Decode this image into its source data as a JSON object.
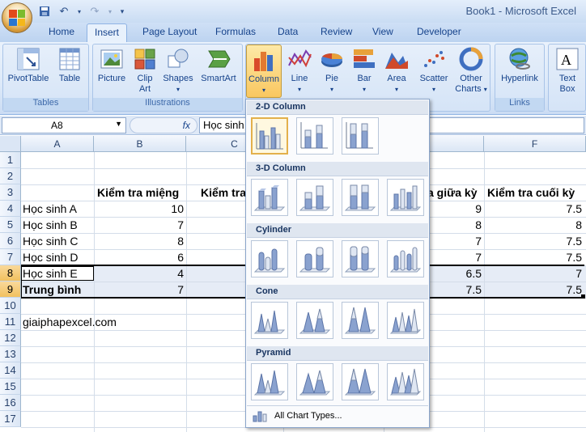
{
  "window": {
    "title": "Book1 - Microsoft Excel"
  },
  "quick_access": {
    "icons": [
      "save-icon",
      "undo-icon",
      "redo-icon",
      "customize-icon"
    ]
  },
  "tabs": [
    "Home",
    "Insert",
    "Page Layout",
    "Formulas",
    "Data",
    "Review",
    "View",
    "Developer"
  ],
  "active_tab": "Insert",
  "ribbon": {
    "groups": {
      "tables": "Tables",
      "illustrations": "Illustrations",
      "links": "Links"
    },
    "buttons": {
      "pivottable": "PivotTable",
      "table": "Table",
      "picture": "Picture",
      "clipart_1": "Clip",
      "clipart_2": "Art",
      "shapes": "Shapes",
      "smartart": "SmartArt",
      "column": "Column",
      "line": "Line",
      "pie": "Pie",
      "bar": "Bar",
      "area": "Area",
      "scatter": "Scatter",
      "other_1": "Other",
      "other_2": "Charts",
      "hyperlink": "Hyperlink",
      "textbox_1": "Text",
      "textbox_2": "Box"
    }
  },
  "formula_bar": {
    "name_box": "A8",
    "fx": "fx",
    "value": "Học sinh E"
  },
  "sheet": {
    "columns": [
      "A",
      "B",
      "C",
      "D",
      "E",
      "F"
    ],
    "rows": [
      "1",
      "2",
      "3",
      "4",
      "5",
      "6",
      "7",
      "8",
      "9",
      "10",
      "11",
      "12",
      "13",
      "14",
      "15",
      "16",
      "17"
    ],
    "headers": {
      "b": "Kiểm tra miệng",
      "c": "Kiểm tra",
      "e": "a giữa kỳ",
      "f": "Kiểm tra cuối kỳ"
    },
    "data": [
      {
        "a": "Học sinh A",
        "b": "10",
        "e": "9",
        "f": "7.5"
      },
      {
        "a": "Học sinh B",
        "b": "7",
        "e": "8",
        "f": "8"
      },
      {
        "a": "Học sinh C",
        "b": "8",
        "e": "7",
        "f": "7.5"
      },
      {
        "a": "Học sinh D",
        "b": "6",
        "e": "7",
        "f": "7.5"
      },
      {
        "a": "Học sinh E",
        "b": "4",
        "e": "6.5",
        "f": "7"
      },
      {
        "a": "Trung bình",
        "b": "7",
        "e": "7.5",
        "f": "7.5"
      }
    ],
    "note": "giaiphapexcel.com"
  },
  "column_dropdown": {
    "sections": [
      "2-D Column",
      "3-D Column",
      "Cylinder",
      "Cone",
      "Pyramid"
    ],
    "all_chart_types": "All Chart Types..."
  }
}
